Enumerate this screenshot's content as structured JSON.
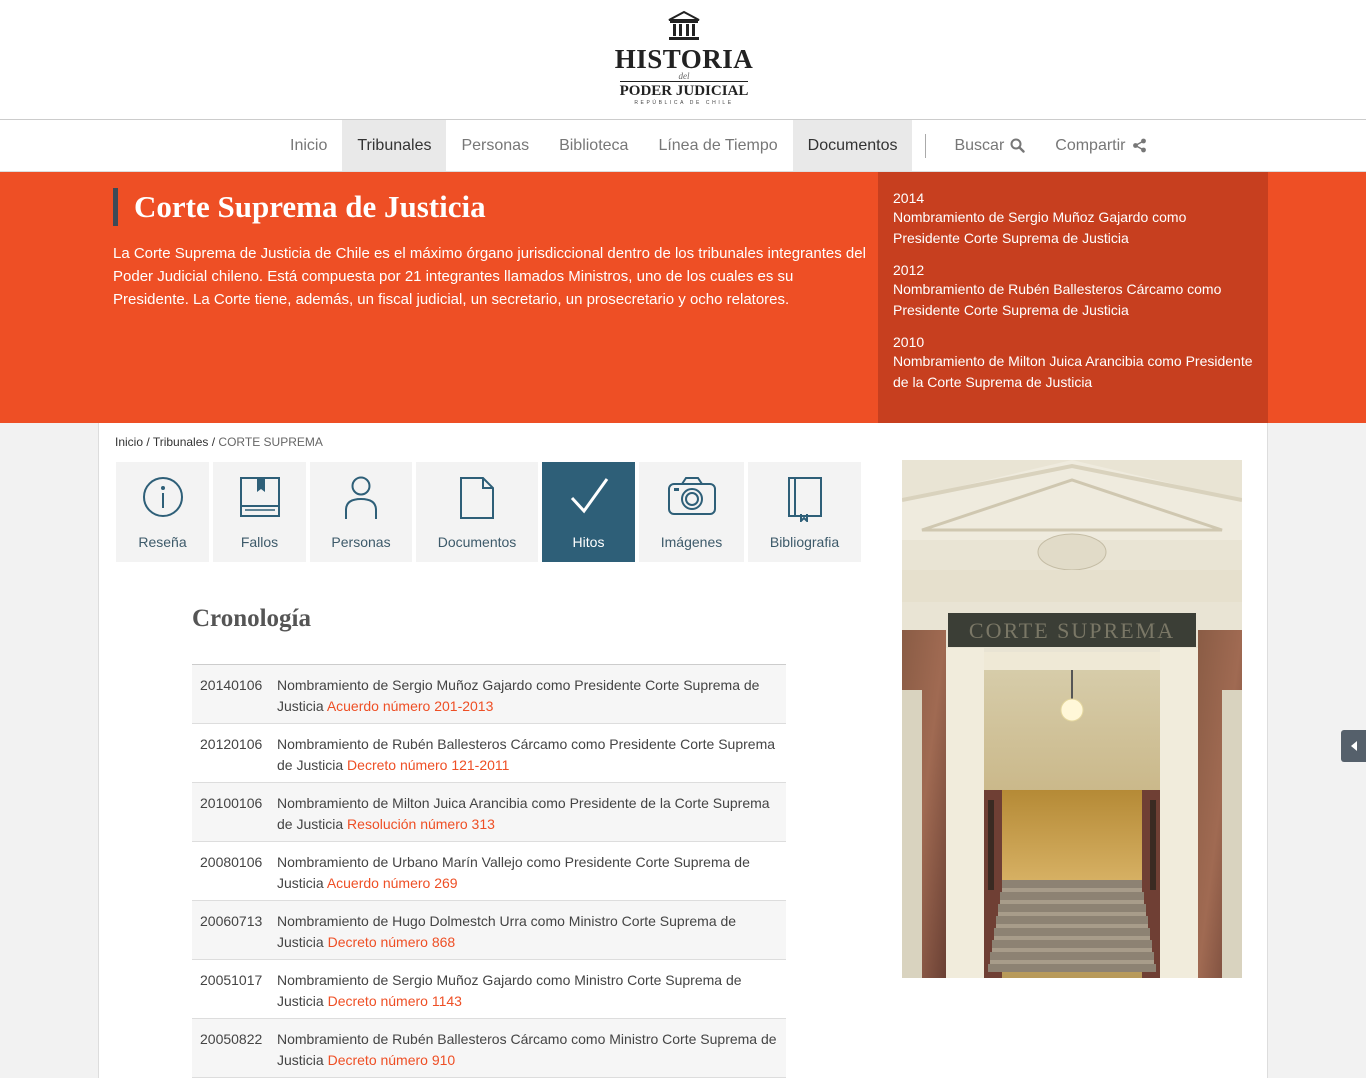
{
  "logo": {
    "line1": "HISTORIA",
    "line2": "del",
    "line3": "PODER JUDICIAL",
    "line4": "REPÚBLICA DE CHILE"
  },
  "nav": {
    "items": [
      {
        "label": "Inicio",
        "active": false
      },
      {
        "label": "Tribunales",
        "active": true
      },
      {
        "label": "Personas",
        "active": false
      },
      {
        "label": "Biblioteca",
        "active": false
      },
      {
        "label": "Línea de Tiempo",
        "active": false
      },
      {
        "label": "Documentos",
        "active": true
      }
    ],
    "search_label": "Buscar",
    "share_label": "Compartir"
  },
  "hero": {
    "title": "Corte Suprema de Justicia",
    "text": "La Corte Suprema de Justicia de Chile es el máximo órgano jurisdiccional dentro de los tribunales integrantes del Poder Judicial chileno. Está compuesta por 21 integrantes llamados Ministros, uno de los cuales es su Presidente. La Corte tiene, además, un fiscal judicial, un secretario, un prosecretario y ocho relatores.",
    "events": [
      {
        "year": "2014",
        "text": "Nombramiento de Sergio Muñoz Gajardo como Presidente Corte Suprema de Justicia"
      },
      {
        "year": "2012",
        "text": "Nombramiento de Rubén Ballesteros Cárcamo como Presidente Corte Suprema de Justicia"
      },
      {
        "year": "2010",
        "text": "Nombramiento de Milton Juica Arancibia como Presidente de la Corte Suprema de Justicia"
      }
    ]
  },
  "breadcrumb": {
    "home": "Inicio",
    "section": "Tribunales",
    "current": "CORTE SUPREMA"
  },
  "tabs": [
    {
      "label": "Reseña",
      "icon": "info-icon"
    },
    {
      "label": "Fallos",
      "icon": "book-icon"
    },
    {
      "label": "Personas",
      "icon": "person-icon"
    },
    {
      "label": "Documentos",
      "icon": "document-icon"
    },
    {
      "label": "Hitos",
      "icon": "checkmark-icon",
      "active": true
    },
    {
      "label": "Imágenes",
      "icon": "camera-icon"
    },
    {
      "label": "Bibliografia",
      "icon": "bookmark-book-icon"
    }
  ],
  "cronologia": {
    "title": "Cronología",
    "rows": [
      {
        "date": "20140106",
        "text": "Nombramiento de Sergio Muñoz Gajardo como Presidente Corte Suprema de Justicia",
        "link": "Acuerdo número 201-2013"
      },
      {
        "date": "20120106",
        "text": "Nombramiento de Rubén Ballesteros Cárcamo como Presidente Corte Suprema de Justicia",
        "link": "Decreto número 121-2011"
      },
      {
        "date": "20100106",
        "text": "Nombramiento de Milton Juica Arancibia como Presidente de la Corte Suprema de Justicia",
        "link": "Resolución número 313"
      },
      {
        "date": "20080106",
        "text": "Nombramiento de Urbano Marín Vallejo como Presidente Corte Suprema de Justicia",
        "link": "Acuerdo número 269"
      },
      {
        "date": "20060713",
        "text": "Nombramiento de Hugo Dolmestch Urra como Ministro Corte Suprema de Justicia",
        "link": "Decreto número 868"
      },
      {
        "date": "20051017",
        "text": "Nombramiento de Sergio Muñoz Gajardo como Ministro Corte Suprema de Justicia",
        "link": "Decreto número 1143"
      },
      {
        "date": "20050822",
        "text": "Nombramiento de Rubén Ballesteros Cárcamo como Ministro Corte Suprema de Justicia",
        "link": "Decreto número 910"
      }
    ]
  },
  "photo": {
    "inscription": "CORTE SUPREMA"
  },
  "colors": {
    "accent": "#ee4f25",
    "accent_dark": "#c73f1f",
    "tab_active": "#2e5f78"
  }
}
